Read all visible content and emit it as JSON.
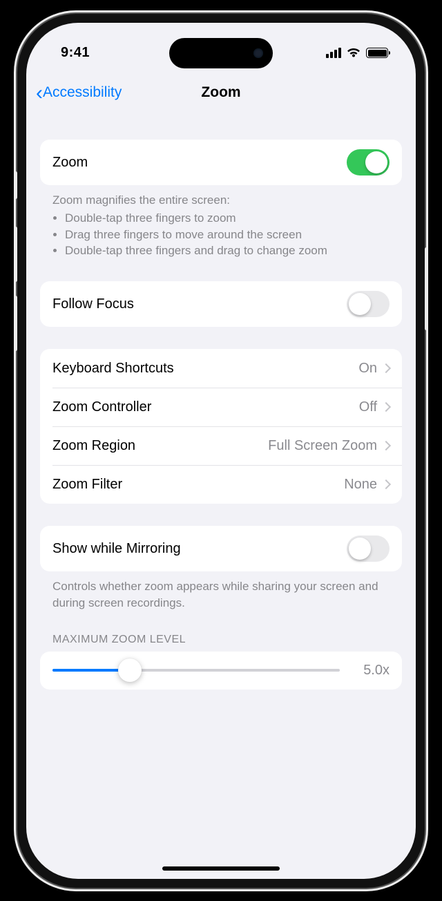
{
  "status": {
    "time": "9:41"
  },
  "nav": {
    "back": "Accessibility",
    "title": "Zoom"
  },
  "zoom": {
    "label": "Zoom",
    "enabled": true,
    "desc_header": "Zoom magnifies the entire screen:",
    "desc_1": "Double-tap three fingers to zoom",
    "desc_2": "Drag three fingers to move around the screen",
    "desc_3": "Double-tap three fingers and drag to change zoom"
  },
  "follow_focus": {
    "label": "Follow Focus",
    "enabled": false
  },
  "options": {
    "keyboard_shortcuts": {
      "label": "Keyboard Shortcuts",
      "value": "On"
    },
    "zoom_controller": {
      "label": "Zoom Controller",
      "value": "Off"
    },
    "zoom_region": {
      "label": "Zoom Region",
      "value": "Full Screen Zoom"
    },
    "zoom_filter": {
      "label": "Zoom Filter",
      "value": "None"
    }
  },
  "mirroring": {
    "label": "Show while Mirroring",
    "enabled": false,
    "desc": "Controls whether zoom appears while sharing your screen and during screen recordings."
  },
  "max_zoom": {
    "header": "MAXIMUM ZOOM LEVEL",
    "value": "5.0x",
    "percent": 27
  }
}
